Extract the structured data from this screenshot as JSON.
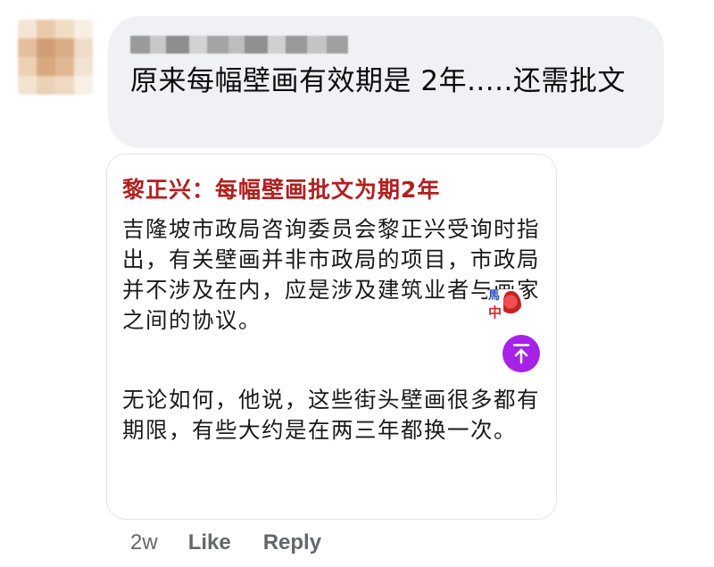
{
  "comment": {
    "text": "原来每幅壁画有效期是 2年.....还需批文"
  },
  "link_preview": {
    "title": "黎正兴：每幅壁画批文为期2年",
    "paragraph_1": "吉隆坡市政局咨询委员会黎正兴受询时指出，有关壁画并非市政局的项目，市政局并不涉及在内，应是涉及建筑业者与画家之间的协议。",
    "paragraph_2": "无论如何，他说，这些街头壁画很多都有期限，有些大约是在两三年都换一次。",
    "watermark_logo": {
      "top": "馬",
      "bottom": "中"
    },
    "scroll_top_icon": "arrow-up-icon",
    "scroll_top_color": "#a622e8",
    "title_color": "#b21f1f"
  },
  "actions": {
    "timestamp": "2w",
    "like_label": "Like",
    "reply_label": "Reply"
  },
  "colors": {
    "bubble_bg": "#eff1f5",
    "muted_text": "#65676b"
  }
}
